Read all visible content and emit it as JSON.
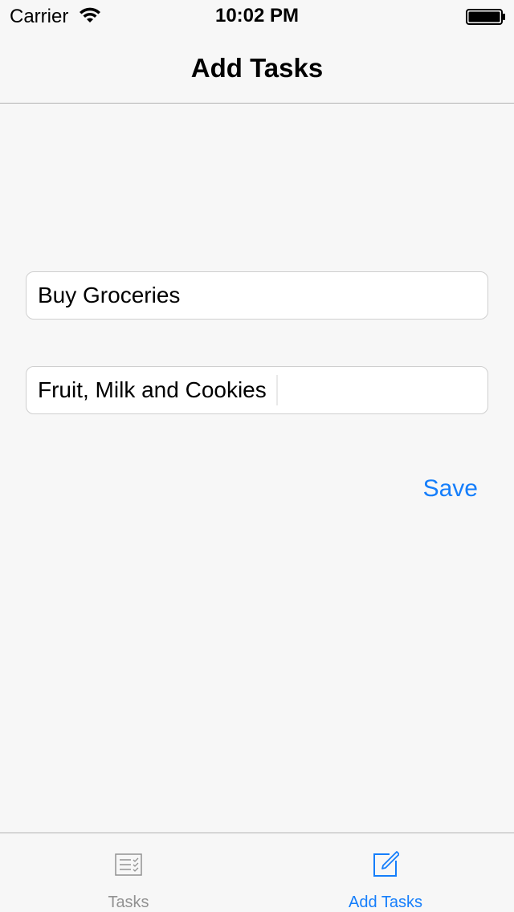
{
  "status_bar": {
    "carrier": "Carrier",
    "time": "10:02 PM",
    "icons": [
      "wifi-icon",
      "battery-icon"
    ]
  },
  "nav": {
    "title": "Add Tasks"
  },
  "form": {
    "task_name_value": "Buy Groceries",
    "task_description_value": "Fruit, Milk and Cookies",
    "save_label": "Save"
  },
  "tab_bar": {
    "tabs": [
      {
        "label": "Tasks",
        "icon": "list-icon",
        "selected": false
      },
      {
        "label": "Add Tasks",
        "icon": "compose-icon",
        "selected": true
      }
    ]
  },
  "colors": {
    "accent": "#157efb",
    "inactive": "#929292",
    "background": "#f7f7f7"
  }
}
